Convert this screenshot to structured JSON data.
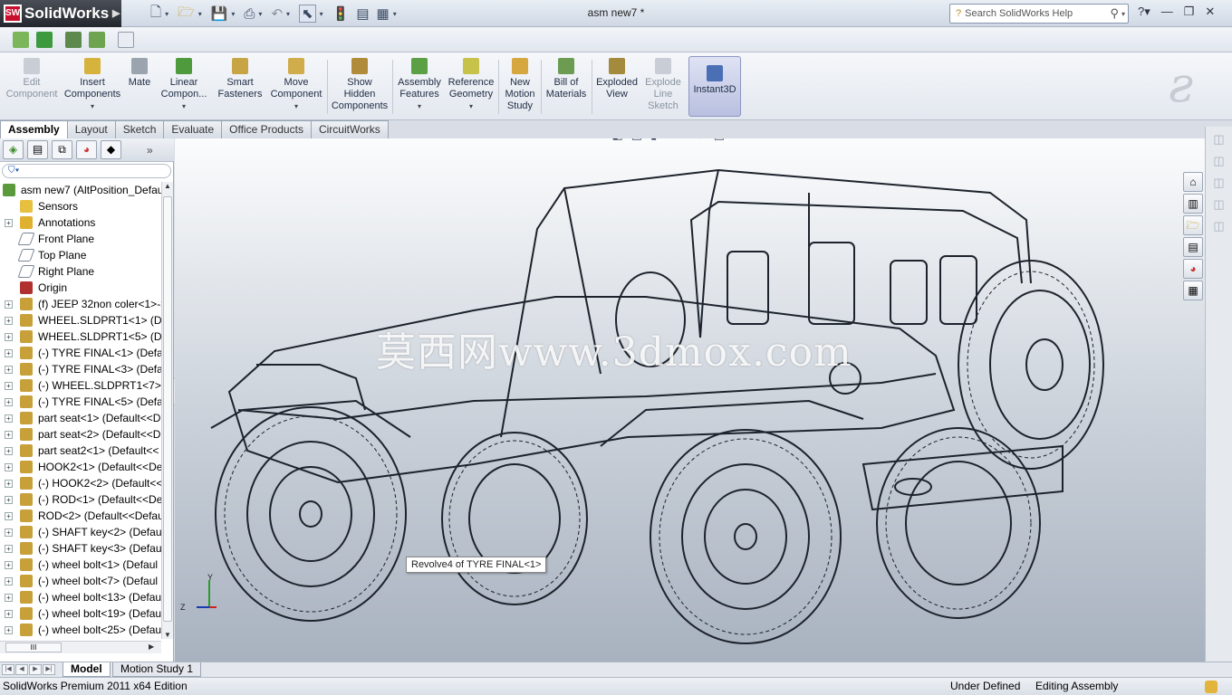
{
  "app": {
    "name": "SolidWorks",
    "logo_mark": "SW"
  },
  "window": {
    "title": "asm new7 *"
  },
  "search": {
    "placeholder": "Search SolidWorks Help"
  },
  "command_manager": {
    "buttons": [
      {
        "id": "edit-component",
        "label": "Edit\nComponent",
        "disabled": true,
        "icon": "edit-component-icon"
      },
      {
        "id": "insert-components",
        "label": "Insert\nComponents",
        "dropdown": true,
        "icon": "insert-components-icon"
      },
      {
        "id": "mate",
        "label": "Mate",
        "icon": "mate-icon"
      },
      {
        "id": "linear-component",
        "label": "Linear\nCompon...",
        "dropdown": true,
        "icon": "linear-pattern-icon"
      },
      {
        "id": "smart-fasteners",
        "label": "Smart\nFasteners",
        "icon": "smart-fasteners-icon"
      },
      {
        "id": "move-component",
        "label": "Move\nComponent",
        "dropdown": true,
        "icon": "move-component-icon"
      },
      {
        "id": "show-hidden",
        "label": "Show\nHidden\nComponents",
        "icon": "show-hidden-icon"
      },
      {
        "id": "assembly-features",
        "label": "Assembly\nFeatures",
        "dropdown": true,
        "icon": "assembly-features-icon"
      },
      {
        "id": "reference-geometry",
        "label": "Reference\nGeometry",
        "dropdown": true,
        "icon": "reference-geometry-icon"
      },
      {
        "id": "new-motion-study",
        "label": "New\nMotion\nStudy",
        "icon": "motion-study-icon"
      },
      {
        "id": "bill-of-materials",
        "label": "Bill of\nMaterials",
        "icon": "bom-icon"
      },
      {
        "id": "exploded-view",
        "label": "Exploded\nView",
        "icon": "exploded-view-icon"
      },
      {
        "id": "explode-line-sketch",
        "label": "Explode\nLine\nSketch",
        "disabled": true,
        "icon": "explode-line-icon"
      },
      {
        "id": "instant3d",
        "label": "Instant3D",
        "active": true,
        "icon": "instant3d-icon"
      }
    ]
  },
  "tabs": [
    {
      "label": "Assembly",
      "active": true
    },
    {
      "label": "Layout"
    },
    {
      "label": "Sketch"
    },
    {
      "label": "Evaluate"
    },
    {
      "label": "Office Products"
    },
    {
      "label": "CircuitWorks"
    }
  ],
  "feature_tree": {
    "root": "asm new7  (AltPosition_Defau",
    "items": [
      {
        "label": "Sensors",
        "icon": "sensor-icon",
        "expand": false
      },
      {
        "label": "Annotations",
        "icon": "annotations-icon",
        "expand": true
      },
      {
        "label": "Front Plane",
        "icon": "plane-icon",
        "expand": false
      },
      {
        "label": "Top Plane",
        "icon": "plane-icon",
        "expand": false
      },
      {
        "label": "Right Plane",
        "icon": "plane-icon",
        "expand": false
      },
      {
        "label": "Origin",
        "icon": "origin-icon",
        "expand": false
      },
      {
        "label": "(f) JEEP 32non coler<1>->",
        "icon": "part-icon",
        "expand": true
      },
      {
        "label": "WHEEL.SLDPRT1<1> (Def",
        "icon": "part-icon",
        "expand": true
      },
      {
        "label": "WHEEL.SLDPRT1<5> (Def",
        "icon": "part-icon",
        "expand": true
      },
      {
        "label": "(-) TYRE FINAL<1> (Defau",
        "icon": "part-icon",
        "expand": true
      },
      {
        "label": "(-) TYRE FINAL<3> (Defau",
        "icon": "part-icon",
        "expand": true
      },
      {
        "label": "(-) WHEEL.SLDPRT1<7> (",
        "icon": "part-icon",
        "expand": true
      },
      {
        "label": "(-) TYRE FINAL<5> (Defau",
        "icon": "part-icon",
        "expand": true
      },
      {
        "label": "part seat<1> (Default<<D",
        "icon": "part-icon",
        "expand": true
      },
      {
        "label": "part seat<2> (Default<<D",
        "icon": "part-icon",
        "expand": true
      },
      {
        "label": "part seat2<1> (Default<<",
        "icon": "part-icon",
        "expand": true
      },
      {
        "label": "HOOK2<1> (Default<<De",
        "icon": "part-icon",
        "expand": true
      },
      {
        "label": "(-) HOOK2<2> (Default<<",
        "icon": "part-icon",
        "expand": true
      },
      {
        "label": "(-) ROD<1> (Default<<De",
        "icon": "part-icon",
        "expand": true
      },
      {
        "label": "ROD<2> (Default<<Defau",
        "icon": "part-icon",
        "expand": true
      },
      {
        "label": "(-) SHAFT key<2> (Defau",
        "icon": "part-icon",
        "expand": true
      },
      {
        "label": "(-) SHAFT key<3> (Defau",
        "icon": "part-icon",
        "expand": true
      },
      {
        "label": "(-) wheel bolt<1> (Defaul",
        "icon": "part-icon",
        "expand": true
      },
      {
        "label": "(-) wheel bolt<7> (Defaul",
        "icon": "part-icon",
        "expand": true
      },
      {
        "label": "(-) wheel bolt<13> (Defau",
        "icon": "part-icon",
        "expand": true
      },
      {
        "label": "(-) wheel bolt<19> (Defau",
        "icon": "part-icon",
        "expand": true
      },
      {
        "label": "(-) wheel bolt<25> (Defau",
        "icon": "part-icon",
        "expand": true
      }
    ],
    "hscroll_label": "III"
  },
  "viewport": {
    "watermark": "莫西网www.3dmox.com",
    "tooltip": "Revolve4 of TYRE FINAL<1>",
    "triad": {
      "y": "Y",
      "z": "Z"
    }
  },
  "bottom_tabs": [
    {
      "label": "Model",
      "active": true
    },
    {
      "label": "Motion Study 1"
    }
  ],
  "status": {
    "product": "SolidWorks Premium 2011 x64 Edition",
    "definition": "Under Defined",
    "mode": "Editing Assembly"
  },
  "colors": {
    "brand": "#c8102e",
    "instant3d_bg": "#c3c9e6",
    "viewport_top": "#fbfcfd",
    "viewport_bottom": "#a8b2bf"
  }
}
